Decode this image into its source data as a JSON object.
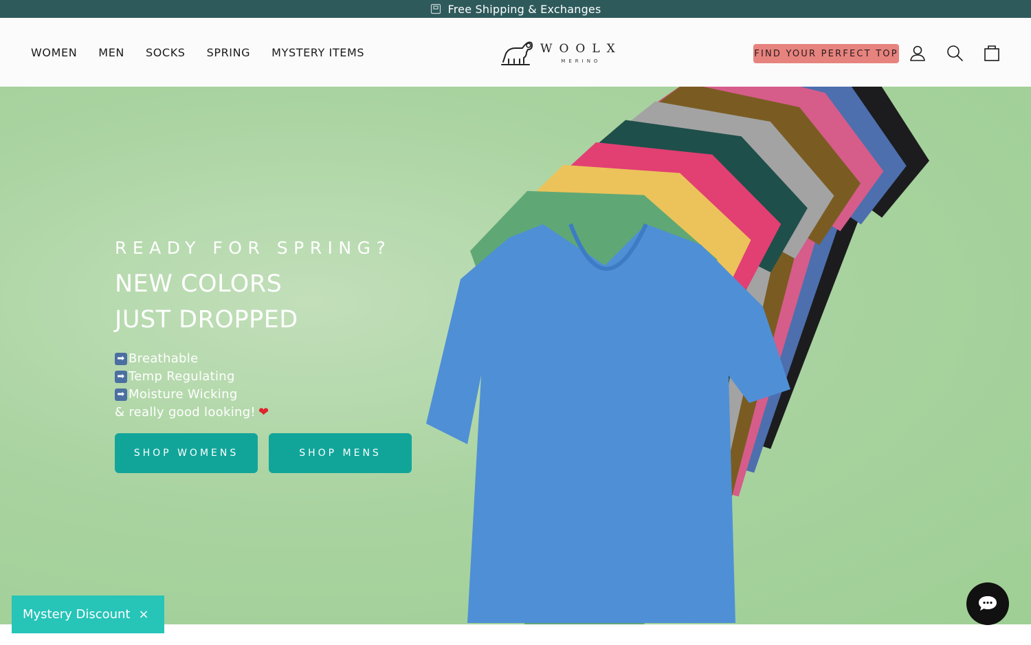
{
  "announcement": {
    "text": "Free Shipping & Exchanges",
    "icon": "gift-box-icon"
  },
  "nav": {
    "items": [
      "WOMEN",
      "MEN",
      "SOCKS",
      "SPRING",
      "MYSTERY ITEMS"
    ]
  },
  "logo": {
    "brand": "WOOLX",
    "sub": "MERINO"
  },
  "header": {
    "quiz_label": "FIND YOUR PERFECT TOP",
    "account_icon": "user-icon",
    "search_icon": "search-icon",
    "cart_icon": "bag-icon"
  },
  "hero": {
    "eyebrow": "READY FOR SPRING?",
    "headline_line1": "NEW COLORS",
    "headline_line2": "JUST DROPPED",
    "features": [
      "Breathable",
      "Temp Regulating",
      "Moisture Wicking"
    ],
    "tagline": "& really good looking!",
    "cta_women": "SHOP WOMENS",
    "cta_men": "SHOP MENS"
  },
  "mystery": {
    "label": "Mystery Discount",
    "close": "×"
  },
  "colors": {
    "announce_bg": "#2e5a5b",
    "quiz_bg": "#e7837f",
    "cta_bg": "#11a59a",
    "mystery_bg": "#27c4b8",
    "hero_bg": "#a9d3a0"
  }
}
